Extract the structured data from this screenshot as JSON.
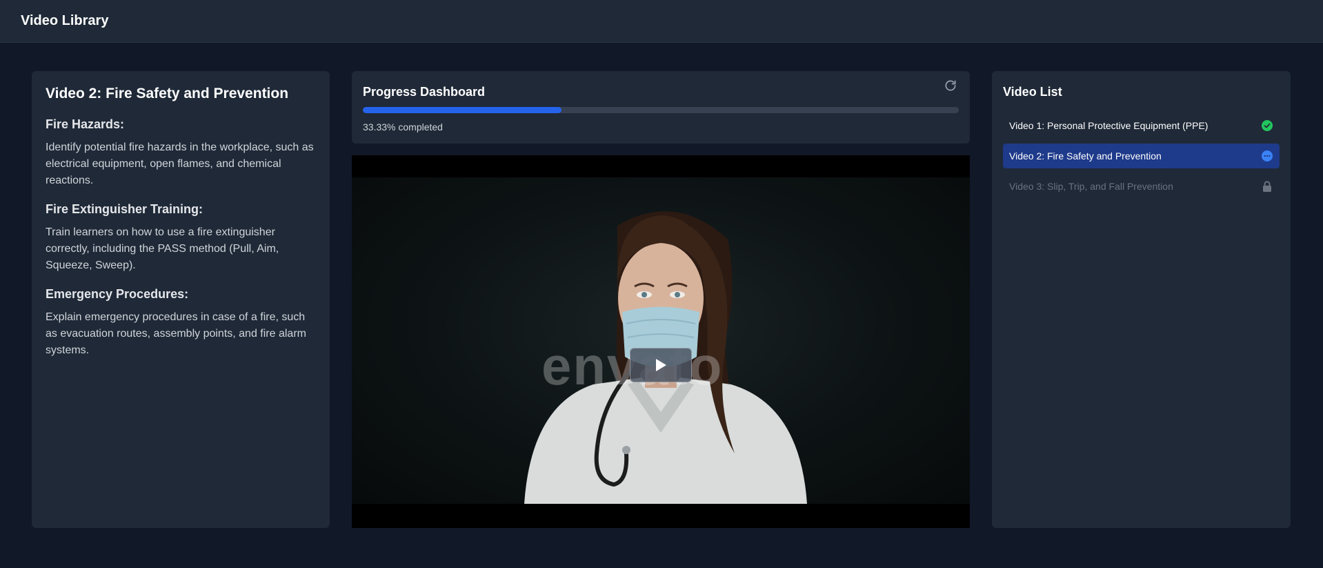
{
  "app": {
    "title": "Video Library"
  },
  "description": {
    "title": "Video 2: Fire Safety and Prevention",
    "sections": [
      {
        "heading": "Fire Hazards:",
        "body": "Identify potential fire hazards in the workplace, such as electrical equipment, open flames, and chemical reactions."
      },
      {
        "heading": "Fire Extinguisher Training:",
        "body": "Train learners on how to use a fire extinguisher correctly, including the PASS method (Pull, Aim, Squeeze, Sweep)."
      },
      {
        "heading": "Emergency Procedures:",
        "body": "Explain emergency procedures in case of a fire, such as evacuation routes, assembly points, and fire alarm systems."
      }
    ]
  },
  "progress": {
    "title": "Progress Dashboard",
    "percent": 33.33,
    "label": "33.33% completed",
    "refresh_icon": "refresh-icon"
  },
  "player": {
    "watermark": "envato",
    "play_icon": "play-icon"
  },
  "video_list": {
    "title": "Video List",
    "items": [
      {
        "label": "Video 1: Personal Protective Equipment (PPE)",
        "status": "completed",
        "icon": "check-circle-icon",
        "color": "#22c55e"
      },
      {
        "label": "Video 2: Fire Safety and Prevention",
        "status": "in-progress",
        "icon": "ellipsis-circle-icon",
        "color": "#3b82f6"
      },
      {
        "label": "Video 3: Slip, Trip, and Fall Prevention",
        "status": "locked",
        "icon": "lock-icon",
        "color": "#6b7280"
      }
    ]
  },
  "colors": {
    "background": "#111827",
    "panel": "#1f2937",
    "accent": "#2563eb",
    "active_item": "#1e3a8a"
  }
}
